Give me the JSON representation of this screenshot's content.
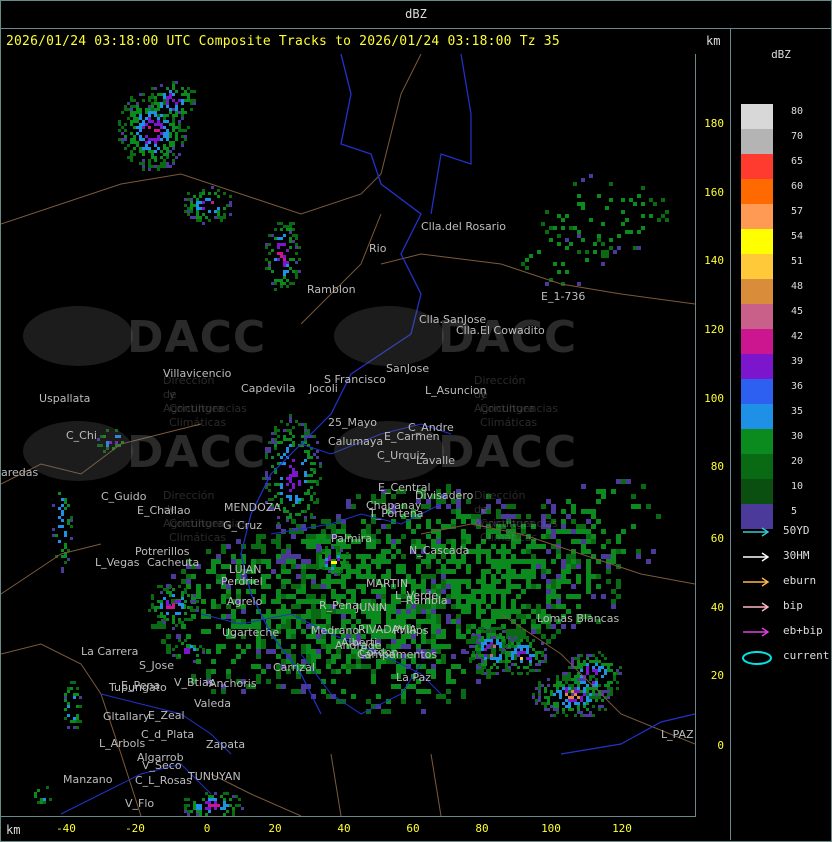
{
  "top_title": "dBZ",
  "header": "2026/01/24 03:18:00 UTC Composite Tracks to 2026/01/24 03:18:00 Tz 35",
  "axis_unit_top": "km",
  "axis_unit_bottom": "km",
  "y_ticks": [
    "180",
    "160",
    "140",
    "120",
    "100",
    "80",
    "60",
    "40",
    "20",
    "0"
  ],
  "x_ticks": [
    "-40",
    "-20",
    "0",
    "20",
    "40",
    "60",
    "80",
    "100",
    "120"
  ],
  "legend": {
    "title": "dBZ",
    "levels": [
      {
        "label": "80",
        "color": "#d8d8d8"
      },
      {
        "label": "70",
        "color": "#b4b4b4"
      },
      {
        "label": "65",
        "color": "#ff3b2f"
      },
      {
        "label": "60",
        "color": "#ff6a00"
      },
      {
        "label": "57",
        "color": "#ff9a55"
      },
      {
        "label": "54",
        "color": "#ffff00"
      },
      {
        "label": "51",
        "color": "#ffc93a"
      },
      {
        "label": "48",
        "color": "#d98c3a"
      },
      {
        "label": "45",
        "color": "#c8608a"
      },
      {
        "label": "42",
        "color": "#cc168f"
      },
      {
        "label": "39",
        "color": "#7b16cc"
      },
      {
        "label": "36",
        "color": "#2d5ff0"
      },
      {
        "label": "35",
        "color": "#1e90e6"
      },
      {
        "label": "30",
        "color": "#0b8a1e"
      },
      {
        "label": "20",
        "color": "#0a6a14"
      },
      {
        "label": "10",
        "color": "#0a4e10"
      },
      {
        "label": "5",
        "color": "#4b3a9a"
      }
    ],
    "tracks": [
      {
        "label": "50YD",
        "color": "#33cccc",
        "kind": "arrow"
      },
      {
        "label": "30HM",
        "color": "#ffffff",
        "kind": "arrow"
      },
      {
        "label": "eburn",
        "color": "#ffb74d",
        "kind": "arrow"
      },
      {
        "label": "bip",
        "color": "#ffb6c1",
        "kind": "arrow"
      },
      {
        "label": "eb+bip",
        "color": "#e040e0",
        "kind": "arrow"
      },
      {
        "label": "current",
        "color": "#00e5e5",
        "kind": "ellipse"
      }
    ]
  },
  "places": [
    {
      "name": "Clla.del Rosario"
    },
    {
      "name": "Rio"
    },
    {
      "name": "Ramblon"
    },
    {
      "name": "E_1-736"
    },
    {
      "name": "Clla.SanJose"
    },
    {
      "name": "Clla.El Cowadito"
    },
    {
      "name": "Villavicencio"
    },
    {
      "name": "S Francisco"
    },
    {
      "name": "SanJose"
    },
    {
      "name": "Capdevila"
    },
    {
      "name": "Jocoli"
    },
    {
      "name": "L_Asuncion"
    },
    {
      "name": "Uspallata"
    },
    {
      "name": "25_Mayo"
    },
    {
      "name": "Calumaya"
    },
    {
      "name": "C_Andre"
    },
    {
      "name": "E_Carmen"
    },
    {
      "name": "C_Chi"
    },
    {
      "name": "C_Urquiz"
    },
    {
      "name": "Lavalle"
    },
    {
      "name": "aredas"
    },
    {
      "name": "E_Central"
    },
    {
      "name": "Divisadero"
    },
    {
      "name": "C_Guido"
    },
    {
      "name": "MENDOZA"
    },
    {
      "name": "E_Challao"
    },
    {
      "name": "G_Cruz"
    },
    {
      "name": "Chapanay"
    },
    {
      "name": "T_Portena"
    },
    {
      "name": "Palmira"
    },
    {
      "name": "N_Cascada"
    },
    {
      "name": "Potrerillos"
    },
    {
      "name": "L_Vegas"
    },
    {
      "name": "Cacheuta"
    },
    {
      "name": "LUJAN"
    },
    {
      "name": "Perdriel"
    },
    {
      "name": "MARTIN"
    },
    {
      "name": "L_Verde"
    },
    {
      "name": "Agrelo"
    },
    {
      "name": "Rambla"
    },
    {
      "name": "R_Pena"
    },
    {
      "name": "JUNIN"
    },
    {
      "name": "Lomas Blancas"
    },
    {
      "name": "Ugarteche"
    },
    {
      "name": "Medrano"
    },
    {
      "name": "RIVADAVIA"
    },
    {
      "name": "Philips"
    },
    {
      "name": "Andrade"
    },
    {
      "name": "Alberti"
    },
    {
      "name": "Campamentos"
    },
    {
      "name": "La Carrera"
    },
    {
      "name": "Cordon"
    },
    {
      "name": "S_Jose"
    },
    {
      "name": "Carrizal"
    },
    {
      "name": "Tupungato"
    },
    {
      "name": "E_Pena"
    },
    {
      "name": "V_Btias"
    },
    {
      "name": "Anchoris"
    },
    {
      "name": "La Paz"
    },
    {
      "name": "Gltallary"
    },
    {
      "name": "E_Zeal"
    },
    {
      "name": "Valeda"
    },
    {
      "name": "C_d_Plata"
    },
    {
      "name": "L_Arbols"
    },
    {
      "name": "Zapata"
    },
    {
      "name": "Algarrob"
    },
    {
      "name": "V_Seco"
    },
    {
      "name": "Manzano"
    },
    {
      "name": "TUNUYAN"
    },
    {
      "name": "C_L_Rosas"
    },
    {
      "name": "V_Flo"
    },
    {
      "name": "L_PAZ"
    }
  ],
  "watermarks": [
    {
      "brand": "DACC",
      "org": "Dirección de Agricultura",
      "org2": "y Contingencias Climáticas"
    },
    {
      "brand": "DACC",
      "org": "Dirección de Agricultura",
      "org2": "y Contingencias Climáticas"
    },
    {
      "brand": "DACC",
      "org": "Dirección de Agricultura",
      "org2": "y Contingencias Climáticas"
    },
    {
      "brand": "DACC",
      "org": "Dirección de Agricultura",
      "org2": "y Contingencias Climáticas"
    }
  ]
}
